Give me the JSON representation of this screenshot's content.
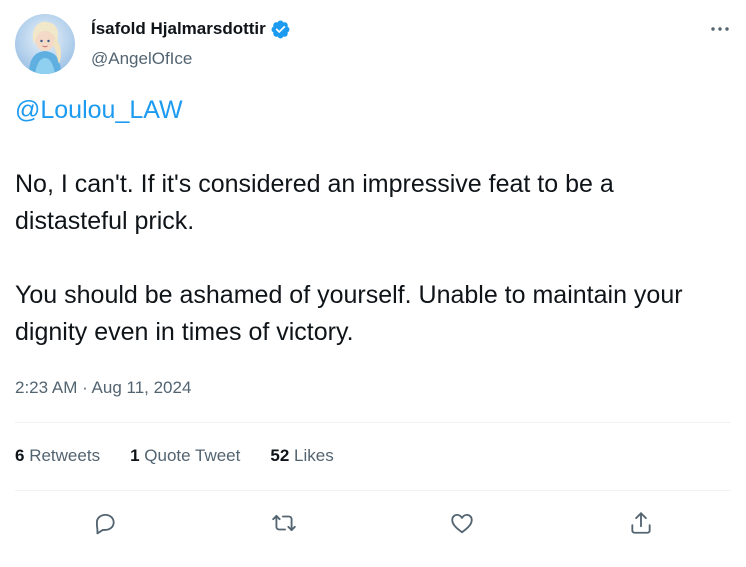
{
  "author": {
    "display_name": "Ísafold Hjalmarsdottir",
    "handle": "@AngelOfIce",
    "verified": true
  },
  "tweet": {
    "mention": "@Loulou_LAW",
    "paragraphs": [
      "No, I can't. If it's considered an impressive feat to be a distasteful prick.",
      "You should be ashamed of yourself. Unable to maintain your dignity even in times of victory."
    ],
    "timestamp": "2:23 AM · Aug 11, 2024"
  },
  "stats": {
    "retweets_count": "6",
    "retweets_label": "Retweets",
    "quotes_count": "1",
    "quotes_label": "Quote Tweet",
    "likes_count": "52",
    "likes_label": "Likes"
  },
  "actions": [
    "reply-icon",
    "retweet-icon",
    "like-icon",
    "share-icon"
  ],
  "colors": {
    "accent": "#1d9bf0",
    "secondary_text": "#536471",
    "primary_text": "#0f1419",
    "divider": "#eff3f4"
  }
}
